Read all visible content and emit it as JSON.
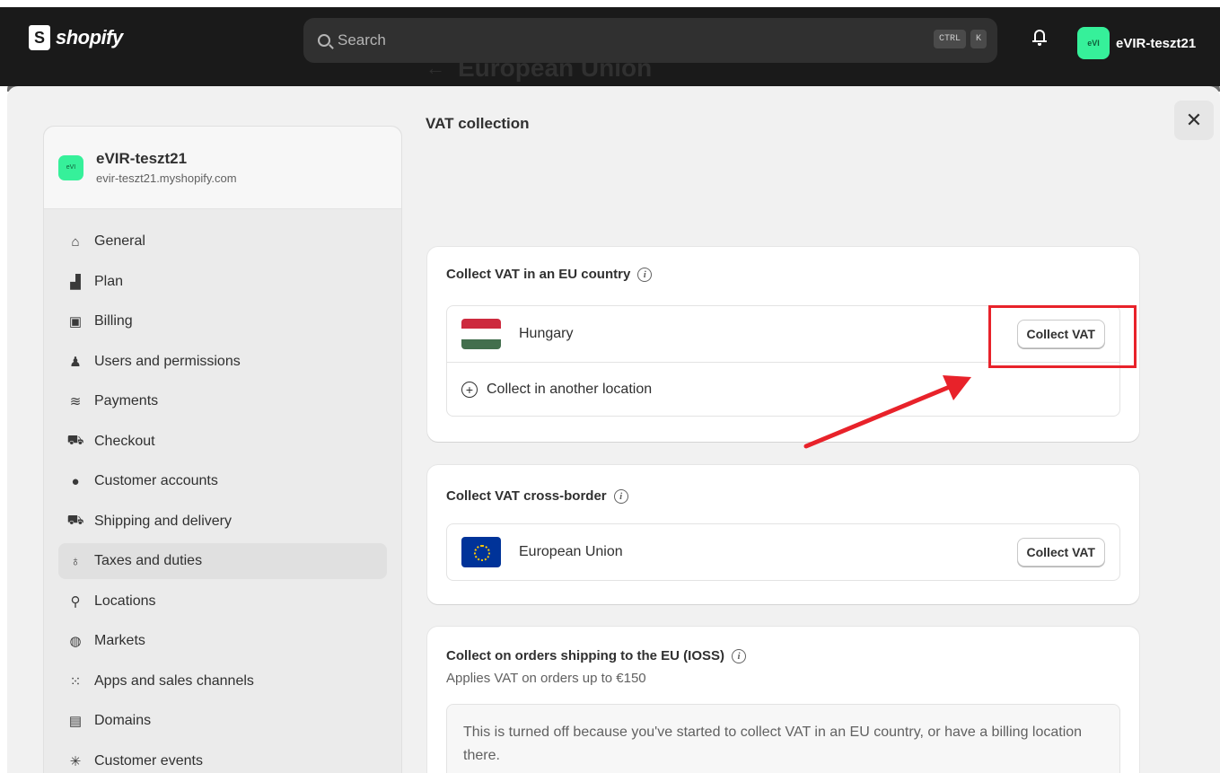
{
  "app": {
    "brand": "shopify",
    "search_placeholder": "Search",
    "shortcut_keys": [
      "CTRL",
      "K"
    ],
    "store_label": "eVIR-teszt21",
    "avatar_text": "eVI"
  },
  "sidebar": {
    "store_name": "eVIR-teszt21",
    "store_url": "evir-teszt21.myshopify.com",
    "avatar_text": "eVI",
    "items": [
      {
        "label": "General",
        "icon": "store-icon"
      },
      {
        "label": "Plan",
        "icon": "plan-icon"
      },
      {
        "label": "Billing",
        "icon": "billing-icon"
      },
      {
        "label": "Users and permissions",
        "icon": "users-icon"
      },
      {
        "label": "Payments",
        "icon": "payments-icon"
      },
      {
        "label": "Checkout",
        "icon": "cart-icon"
      },
      {
        "label": "Customer accounts",
        "icon": "person-icon"
      },
      {
        "label": "Shipping and delivery",
        "icon": "truck-icon"
      },
      {
        "label": "Taxes and duties",
        "icon": "tax-bag-icon",
        "active": true
      },
      {
        "label": "Locations",
        "icon": "location-pin-icon"
      },
      {
        "label": "Markets",
        "icon": "globe-icon"
      },
      {
        "label": "Apps and sales channels",
        "icon": "apps-icon"
      },
      {
        "label": "Domains",
        "icon": "domains-icon"
      },
      {
        "label": "Customer events",
        "icon": "sparkle-icon"
      }
    ]
  },
  "page": {
    "title": "European Union",
    "section_title": "VAT collection"
  },
  "cards": {
    "eu_country": {
      "title": "Collect VAT in an EU country",
      "country": "Hungary",
      "button": "Collect VAT",
      "add_label": "Collect in another location"
    },
    "cross_border": {
      "title": "Collect VAT cross-border",
      "region": "European Union",
      "button": "Collect VAT"
    },
    "ioss": {
      "title": "Collect on orders shipping to the EU (IOSS)",
      "subtitle": "Applies VAT on orders up to €150",
      "notice": "This is turned off because you've started to collect VAT in an EU country, or have a billing location there."
    }
  },
  "annotation": {
    "highlight_color": "#e8222a"
  },
  "colors": {
    "topbar": "#1a1a1a",
    "avatar": "#36f09a",
    "hungary_red": "#cd2a3e",
    "hungary_green": "#436f4d",
    "eu_blue": "#003399"
  }
}
